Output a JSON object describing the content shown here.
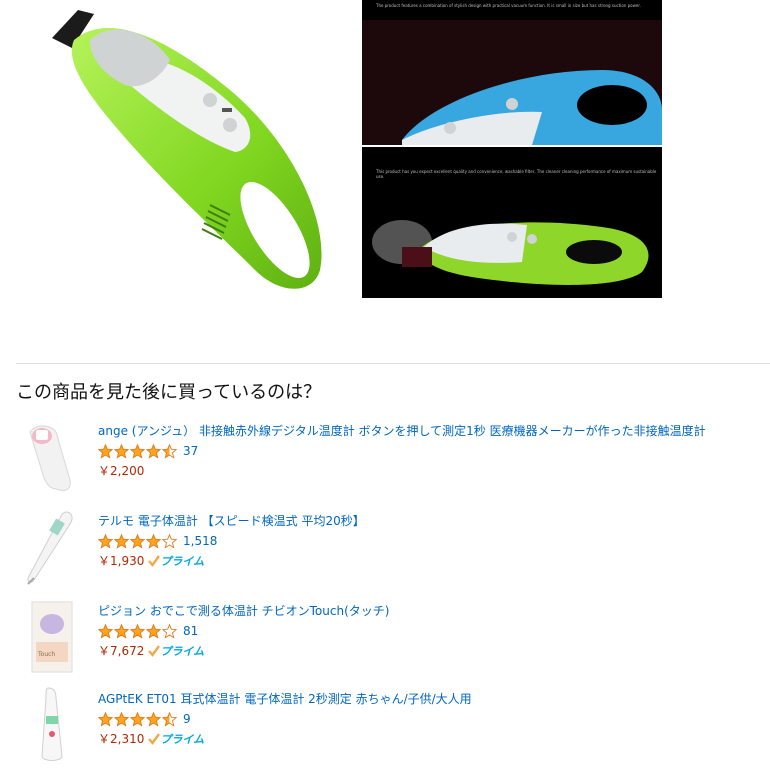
{
  "hero": {
    "caption_top": "The product features a combination of stylish design with practical vacuum function. It is small in size but has strong suction power.",
    "caption_bottom": "This product has you expect excellent quality and convenience, washable filter, The cleaner cleaning performance of maximum sustainable use."
  },
  "section": {
    "title": "この商品を見た後に買っているのは？"
  },
  "recommendations": [
    {
      "title": "ange (アンジュ） 非接触赤外線デジタル温度計 ボタンを押して測定1秒 医療機器メーカーが作った非接触温度計",
      "rating": 4.5,
      "reviews": "37",
      "price": "￥2,200",
      "prime": false
    },
    {
      "title": "テルモ 電子体温計 【スピード検温式 平均20秒】",
      "rating": 4.0,
      "reviews": "1,518",
      "price": "￥1,930",
      "prime": true
    },
    {
      "title": "ピジョン おでこで測る体温計 チビオンTouch(タッチ)",
      "rating": 4.0,
      "reviews": "81",
      "price": "￥7,672",
      "prime": true
    },
    {
      "title": "AGPtEK ET01 耳式体温計 電子体温計 2秒測定 赤ちゃん/子供/大人用",
      "rating": 4.5,
      "reviews": "9",
      "price": "￥2,310",
      "prime": true
    }
  ],
  "prime_label": "プライム",
  "colors": {
    "link": "#0066c0",
    "price": "#b12704",
    "star": "#ffa41c",
    "prime": "#00a8e1"
  }
}
